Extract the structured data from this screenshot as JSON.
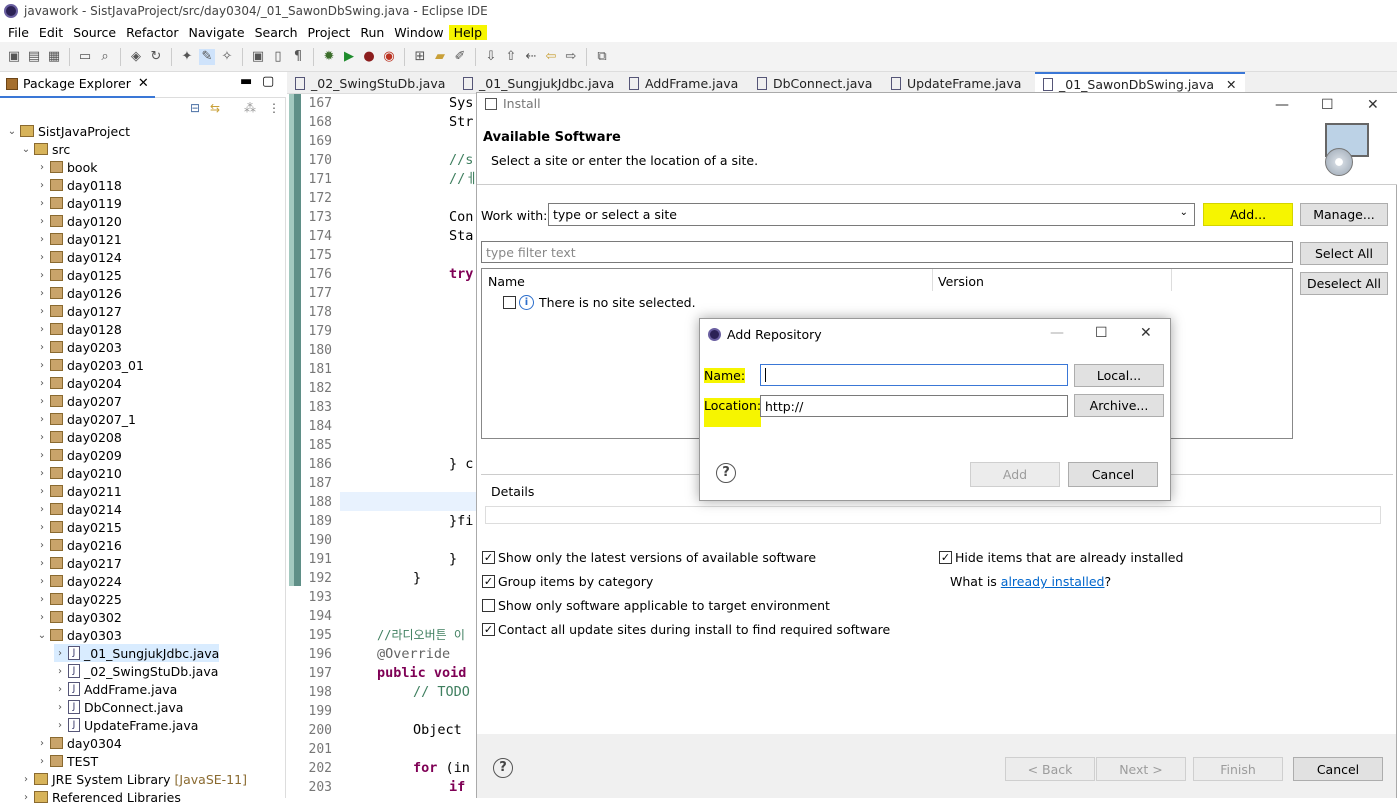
{
  "window": {
    "title": "javawork - SistJavaProject/src/day0304/_01_SawonDbSwing.java - Eclipse IDE"
  },
  "menu": [
    "File",
    "Edit",
    "Source",
    "Refactor",
    "Navigate",
    "Search",
    "Project",
    "Run",
    "Window",
    "Help"
  ],
  "package_explorer": {
    "tab_label": "Package Explorer",
    "project": "SistJavaProject",
    "src": "src",
    "packages_top": [
      "book",
      "day0118",
      "day0119",
      "day0120",
      "day0121",
      "day0124",
      "day0125",
      "day0126",
      "day0127",
      "day0128",
      "day0203",
      "day0203_01",
      "day0204",
      "day0207",
      "day0207_1",
      "day0208",
      "day0209",
      "day0210",
      "day0211",
      "day0214",
      "day0215",
      "day0216",
      "day0217",
      "day0224",
      "day0225",
      "day0302",
      "day0303"
    ],
    "day0303_files": [
      "_01_SungjukJdbc.java",
      "_02_SwingStuDb.java",
      "AddFrame.java",
      "DbConnect.java",
      "UpdateFrame.java"
    ],
    "packages_bottom": [
      "day0304",
      "TEST"
    ],
    "jre": "JRE System Library",
    "jre_version": "[JavaSE-11]",
    "ref_libs": "Referenced Libraries"
  },
  "editor_tabs": [
    "_02_SwingStuDb.java",
    "_01_SungjukJdbc.java",
    "AddFrame.java",
    "DbConnect.java",
    "UpdateFrame.java",
    "_01_SawonDbSwing.java"
  ],
  "line_numbers": [
    "167",
    "168",
    "169",
    "170",
    "171",
    "172",
    "173",
    "174",
    "175",
    "176",
    "177",
    "178",
    "179",
    "180",
    "181",
    "182",
    "183",
    "184",
    "185",
    "186",
    "187",
    "188",
    "189",
    "190",
    "191",
    "192",
    "193",
    "194",
    "195",
    "196",
    "197",
    "198",
    "199",
    "200",
    "201",
    "202",
    "203"
  ],
  "code": {
    "l167": "Sys",
    "l168": "Str",
    "l170": "//s",
    "l171": "//ㅔ",
    "l173": "Con",
    "l174": "Sta",
    "l176": "try",
    "l186": "} c",
    "l189": "}fi",
    "l191": "}",
    "l192": "}",
    "l195": "//라디오버튼 이",
    "l196": "@Override",
    "l197_kw": "public void",
    "l198": "// TODO",
    "l200": "Object",
    "l202_kw": "for",
    "l202": " (in",
    "l203": "if"
  },
  "install": {
    "title": "Install",
    "header_title": "Available Software",
    "header_sub": "Select a site or enter the location of a site.",
    "work_with_label": "Work with:",
    "work_with_value": "type or select a site",
    "add_btn": "Add...",
    "manage_btn": "Manage...",
    "filter_placeholder": "type filter text",
    "select_all": "Select All",
    "deselect_all": "Deselect All",
    "col_name": "Name",
    "col_version": "Version",
    "no_site": "There is no site selected.",
    "details": "Details",
    "opt1": "Show only the latest versions of available software",
    "opt2": "Group items by category",
    "opt3": "Show only software applicable to target environment",
    "opt4": "Contact all update sites during install to find required software",
    "opt5": "Hide items that are already installed",
    "what_is": "What is",
    "already_installed": "already installed",
    "q": "?",
    "back": "< Back",
    "next": "Next >",
    "finish": "Finish",
    "cancel": "Cancel"
  },
  "add_repository": {
    "title": "Add Repository",
    "name_label": "Name:",
    "location_label": "Location:",
    "name_value": "",
    "location_value": "http://",
    "local_btn": "Local...",
    "archive_btn": "Archive...",
    "add_btn": "Add",
    "cancel_btn": "Cancel"
  },
  "colors": {
    "highlight": "#f6f500",
    "link": "#0066cc"
  }
}
